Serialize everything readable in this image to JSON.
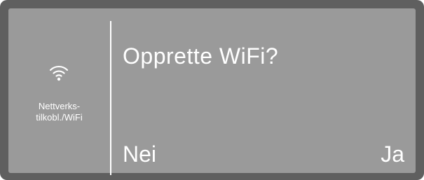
{
  "sidebar": {
    "icon": "wifi-icon",
    "label_line1": "Nettverks-",
    "label_line2": "tilkobl./WiFi"
  },
  "dialog": {
    "question": "Opprette WiFi?",
    "no_label": "Nei",
    "yes_label": "Ja"
  },
  "colors": {
    "bezel": "#5f5f5f",
    "screen": "#9a9a9a",
    "text": "#ffffff"
  }
}
